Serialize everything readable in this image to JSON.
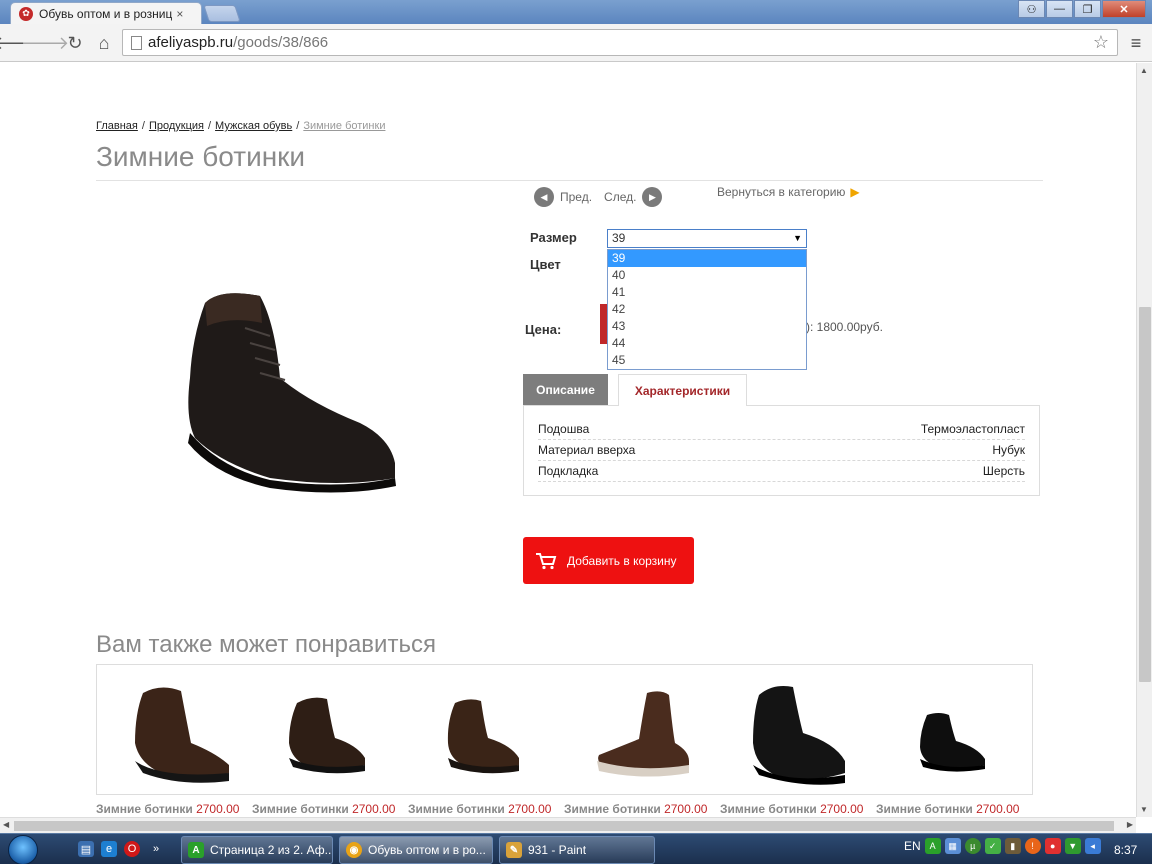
{
  "browser": {
    "tab_title": "Обувь оптом и в розниц",
    "tab_close": "×",
    "url_host": "afeliyaspb.ru",
    "url_path": "/goods/38/866",
    "window_buttons": {
      "user": "⚇",
      "minimize": "—",
      "maximize": "❐",
      "close": "✕"
    }
  },
  "page": {
    "breadcrumb": {
      "home": "Главная",
      "products": "Продукция",
      "mens": "Мужская обувь",
      "current": "Зимние ботинки",
      "sep": "/"
    },
    "title": "Зимние ботинки",
    "pager": {
      "prev": "Пред.",
      "next": "След.",
      "back": "Вернуться в категорию"
    },
    "labels": {
      "size": "Размер",
      "color": "Цвет",
      "price": "Цена:"
    },
    "price_text": "): 1800.00руб.",
    "size_select": {
      "selected": "39",
      "options": [
        "39",
        "40",
        "41",
        "42",
        "43",
        "44",
        "45"
      ]
    },
    "tabs": {
      "description": "Описание",
      "specs": "Характеристики"
    },
    "specs": [
      {
        "name": "Подошва",
        "value": "Термоэластопласт"
      },
      {
        "name": "Материал вверха",
        "value": "Нубук"
      },
      {
        "name": "Подкладка",
        "value": "Шерсть"
      }
    ],
    "cart_button": "Добавить в корзину",
    "also_title": "Вам также может понравиться",
    "also_items": [
      {
        "name": "Зимние ботинки",
        "price": "2700.00"
      },
      {
        "name": "Зимние ботинки",
        "price": "2700.00"
      },
      {
        "name": "Зимние ботинки",
        "price": "2700.00"
      },
      {
        "name": "Зимние ботинки",
        "price": "2700.00"
      },
      {
        "name": "Зимние ботинки",
        "price": "2700.00"
      },
      {
        "name": "Зимние ботинки",
        "price": "2700.00"
      }
    ]
  },
  "taskbar": {
    "items": [
      {
        "label": "Страница 2 из 2. Аф...",
        "icon": "A"
      },
      {
        "label": "Обувь оптом и в ро...",
        "icon": "◉"
      },
      {
        "label": "931 - Paint",
        "icon": "✎"
      }
    ],
    "lang": "EN",
    "clock": "8:37"
  },
  "colors": {
    "accent_red": "#ee1111",
    "price_red": "#c0282a",
    "tab_active_text": "#a3272a",
    "select_highlight": "#3399ff"
  }
}
